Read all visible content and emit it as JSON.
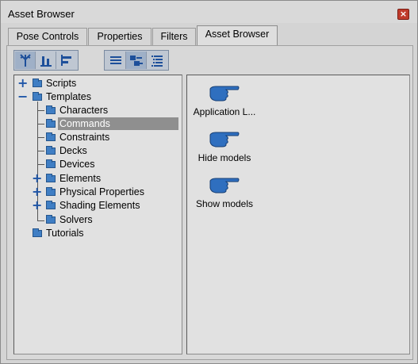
{
  "window": {
    "title": "Asset Browser"
  },
  "tabs": [
    {
      "label": "Pose Controls",
      "active": false
    },
    {
      "label": "Properties",
      "active": false
    },
    {
      "label": "Filters",
      "active": false
    },
    {
      "label": "Asset Browser",
      "active": true
    }
  ],
  "toolbar": {
    "view_buttons": [
      {
        "name": "tree-view-icon",
        "pressed": true
      },
      {
        "name": "bar-chart-icon",
        "pressed": false
      },
      {
        "name": "side-bars-icon",
        "pressed": false
      }
    ],
    "list_buttons": [
      {
        "name": "list-view-icon",
        "pressed": false
      },
      {
        "name": "icon-view-icon",
        "pressed": true
      },
      {
        "name": "detail-list-icon",
        "pressed": false
      }
    ]
  },
  "tree": {
    "scripts": "Scripts",
    "templates": "Templates",
    "characters": "Characters",
    "commands": "Commands",
    "constraints": "Constraints",
    "decks": "Decks",
    "devices": "Devices",
    "elements": "Elements",
    "physical_properties": "Physical Properties",
    "shading_elements": "Shading Elements",
    "solvers": "Solvers",
    "tutorials": "Tutorials",
    "selected": "Commands"
  },
  "assets": {
    "items": [
      {
        "label": "Application L...",
        "icon": "pointing-hand-icon"
      },
      {
        "label": "Hide models",
        "icon": "pointing-hand-icon"
      },
      {
        "label": "Show models",
        "icon": "pointing-hand-icon"
      }
    ]
  },
  "colors": {
    "accent_blue": "#3f7ec4",
    "selection_gray": "#8f8f8f",
    "close_red": "#bf3a2b"
  }
}
